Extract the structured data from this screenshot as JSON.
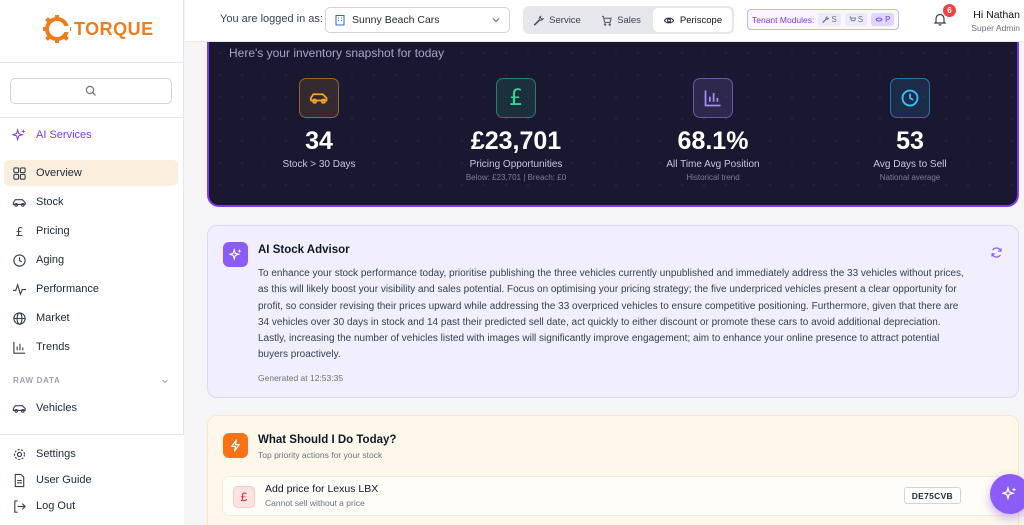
{
  "brand": {
    "name": "TORQUE",
    "color": "#f07d1c"
  },
  "sidebar": {
    "search_icon": "search-icon",
    "ai_services": "AI Services",
    "items": [
      {
        "label": "Overview",
        "icon": "grid-icon",
        "active": true
      },
      {
        "label": "Stock",
        "icon": "car-icon"
      },
      {
        "label": "Pricing",
        "icon": "pound-icon"
      },
      {
        "label": "Aging",
        "icon": "clock-icon"
      },
      {
        "label": "Performance",
        "icon": "pulse-icon"
      },
      {
        "label": "Market",
        "icon": "globe-icon"
      },
      {
        "label": "Trends",
        "icon": "bar-chart-icon"
      }
    ],
    "raw_data_label": "RAW DATA",
    "raw_items": [
      {
        "label": "Vehicles",
        "icon": "car-icon"
      }
    ],
    "bottom": [
      {
        "label": "Settings",
        "icon": "gear-icon"
      },
      {
        "label": "User Guide",
        "icon": "document-icon"
      },
      {
        "label": "Log Out",
        "icon": "logout-icon"
      }
    ]
  },
  "header": {
    "logged_in_label": "You are logged in as:",
    "dealer": "Sunny Beach Cars",
    "modules": [
      {
        "label": "Service",
        "icon": "wrench-icon"
      },
      {
        "label": "Sales",
        "icon": "cart-icon"
      },
      {
        "label": "Periscope",
        "icon": "eye-icon",
        "active": true
      }
    ],
    "tenant_label": "Tenant Modules:",
    "tenant_chips": [
      "S",
      "S",
      "P"
    ],
    "notifications": "6",
    "user_name": "Hi Nathan",
    "user_role": "Super Admin"
  },
  "hero": {
    "subtitle": "Here's your inventory snapshot for today",
    "stats": [
      {
        "value": "34",
        "label": "Stock > 30 Days",
        "sub": "",
        "color": "#f5a623"
      },
      {
        "value": "£23,701",
        "label": "Pricing Opportunities",
        "sub": "Below: £23,701 | Breach: £0",
        "color": "#34d399"
      },
      {
        "value": "68.1%",
        "label": "All Time Avg Position",
        "sub": "Historical trend",
        "color": "#a78bfa"
      },
      {
        "value": "53",
        "label": "Avg Days to Sell",
        "sub": "National average",
        "color": "#38bdf8"
      }
    ]
  },
  "advisor": {
    "title": "AI Stock Advisor",
    "text": "To enhance your stock performance today, prioritise publishing the three vehicles currently unpublished and immediately address the 33 vehicles without prices, as this will likely boost your visibility and sales potential. Focus on optimising your pricing strategy; the five underpriced vehicles present a clear opportunity for profit, so consider revising their prices upward while addressing the 33 overpriced vehicles to ensure competitive positioning. Furthermore, given that there are 34 vehicles over 30 days in stock and 14 past their predicted sell date, act quickly to either discount or promote these cars to avoid additional depreciation. Lastly, increasing the number of vehicles listed with images will significantly improve engagement; aim to enhance your online presence to attract potential buyers proactively.",
    "generated": "Generated at 12:53:35"
  },
  "todo": {
    "title": "What Should I Do Today?",
    "subtitle": "Top priority actions for your stock",
    "items": [
      {
        "title": "Add price for Lexus LBX",
        "sub": "Cannot sell without a price",
        "plate": "DE75CVB",
        "icon": "£"
      }
    ]
  }
}
